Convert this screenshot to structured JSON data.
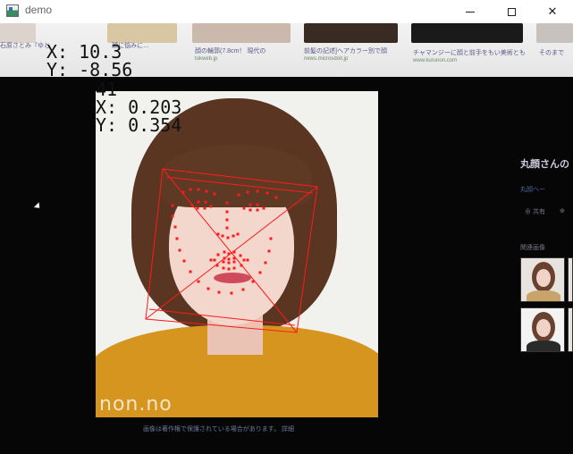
{
  "window": {
    "title": "demo",
    "minimize_icon": "minimize-icon",
    "maximize_icon": "maximize-icon",
    "close_icon": "close-icon",
    "close_glyph": "✕"
  },
  "overlay": {
    "head_x": "X: 10.3",
    "head_y": "Y: -8.56",
    "index": "41",
    "point_x": "X: 0.203",
    "point_y": "Y: 0.354"
  },
  "colors": {
    "landmark": "#ff1a1a",
    "box": "#ff1a1a"
  },
  "background_page": {
    "top_captions": [
      "石原さとみ『ゆと",
      "顔に悩みに…",
      "顔の輪郭(7.8cm！ 現代の",
      "前髪の記述]ヘアカラー別で顔",
      "チャマンジーに顔と前手をもい美術とも",
      "そのまで"
    ],
    "top_sources": [
      "",
      "",
      "tokweb.jp",
      "news.microsdoit.jp",
      "www.kurunon.com",
      ""
    ],
    "photo_brand": "non.no",
    "caption": "画像は著作権で保護されている場合があります。 詳細",
    "sidebar_title": "丸顔さんの",
    "sidebar_sub": "丸顔ヘー",
    "sidebar_actions": [
      "⊕ 共有",
      "⊕"
    ],
    "sidebar_related": "関連画像"
  }
}
